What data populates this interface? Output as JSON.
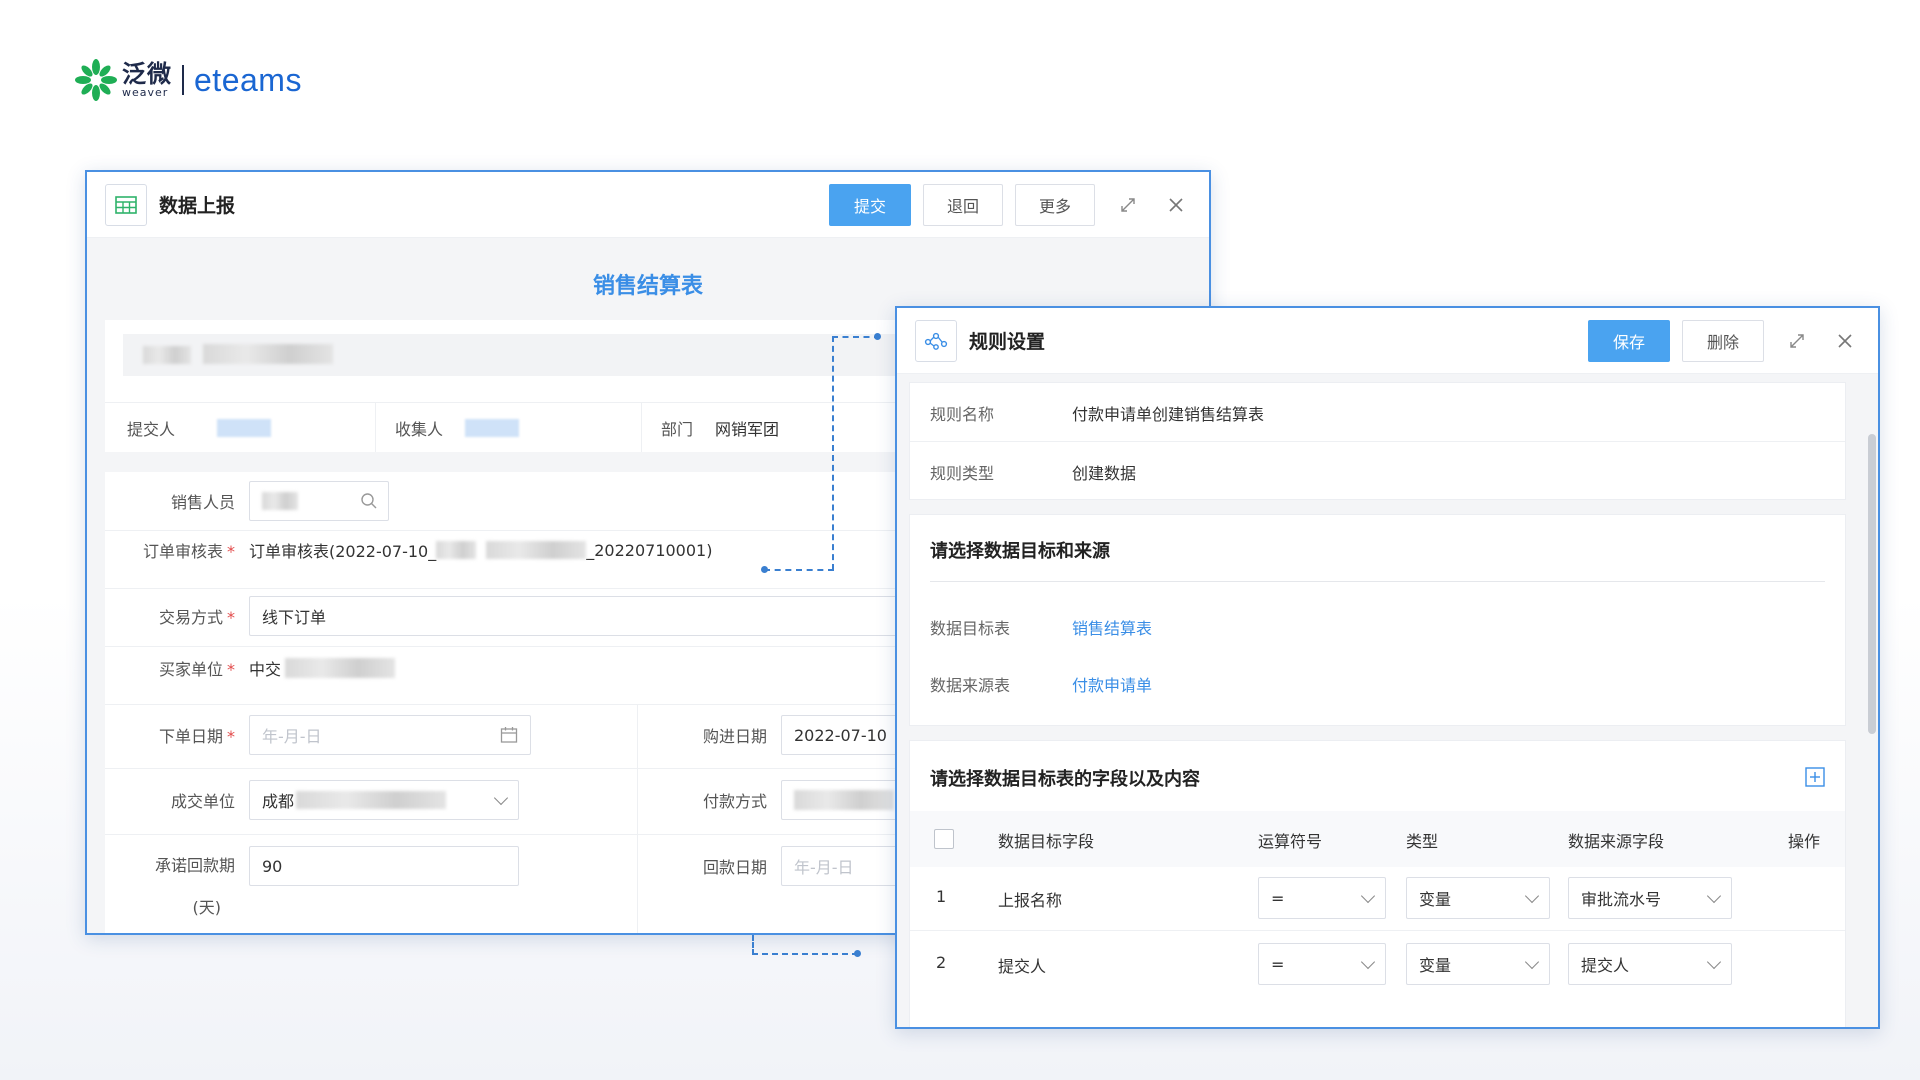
{
  "brand": {
    "cn": "泛微",
    "cn_sub": "weaver",
    "en": "eteams",
    "accent": "#1a66d2",
    "leaf": "#1fae55"
  },
  "window1": {
    "title": "数据上报",
    "buttons": {
      "submit": "提交",
      "return": "退回",
      "more": "更多"
    },
    "form_title": "销售结算表",
    "info": {
      "submitter_label": "提交人",
      "collector_label": "收集人",
      "dept_label": "部门",
      "dept_value": "网销军团"
    },
    "fields": {
      "salesperson_label": "销售人员",
      "order_review_label": "订单审核表",
      "order_review_value_prefix": "订单审核表(2022-07-10_",
      "order_review_value_suffix": "_20220710001)",
      "trade_label": "交易方式",
      "trade_value": "线下订单",
      "buyer_label": "买家单位",
      "buyer_value_prefix": "中交",
      "order_date_label": "下单日期",
      "order_date_placeholder": "年-月-日",
      "purchase_date_label": "购进日期",
      "purchase_date_value": "2022-07-10",
      "deal_unit_label": "成交单位",
      "deal_unit_prefix": "成都",
      "payment_label": "付款方式",
      "promise_label": "承诺回款期",
      "promise_unit": "(天)",
      "promise_value": "90",
      "return_date_label": "回款日期",
      "return_date_placeholder": "年-月-日"
    }
  },
  "window2": {
    "title": "规则设置",
    "buttons": {
      "save": "保存",
      "delete": "删除"
    },
    "rule_name_label": "规则名称",
    "rule_name_value": "付款申请单创建销售结算表",
    "rule_type_label": "规则类型",
    "rule_type_value": "创建数据",
    "section1_title": "请选择数据目标和来源",
    "target_label": "数据目标表",
    "target_value": "销售结算表",
    "source_label": "数据来源表",
    "source_value": "付款申请单",
    "section2_title": "请选择数据目标表的字段以及内容",
    "table_headers": [
      "数据目标字段",
      "运算符号",
      "类型",
      "数据来源字段",
      "操作"
    ],
    "rows": [
      {
        "index": "1",
        "field": "上报名称",
        "op": "=",
        "type": "变量",
        "source": "审批流水号"
      },
      {
        "index": "2",
        "field": "提交人",
        "op": "=",
        "type": "变量",
        "source": "提交人"
      }
    ]
  }
}
